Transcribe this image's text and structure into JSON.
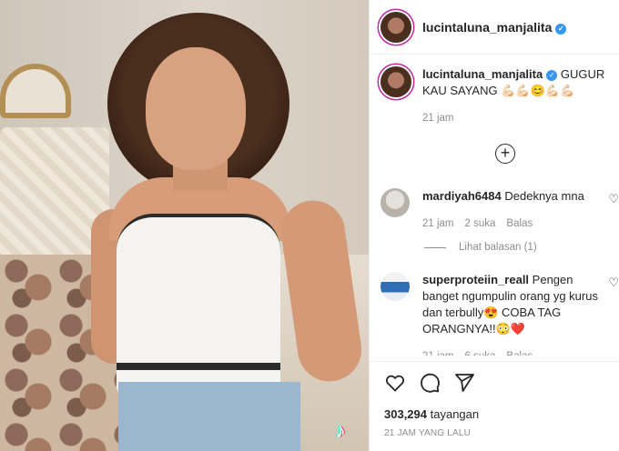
{
  "post": {
    "username": "lucintaluna_manjalita",
    "verified_icon": "verified-badge-icon",
    "caption_text": "GUGUR KAU SAYANG 💪🏻💪🏻😊💪🏻💪🏻",
    "caption_time": "21 jam",
    "views_count": "303,294",
    "views_label": "tayangan",
    "posted_time": "21 JAM YANG LALU"
  },
  "media": {
    "watermark_icon": "tiktok-logo-icon",
    "watermark_glyph": "♪"
  },
  "comments": [
    {
      "username": "mardiyah6484",
      "text": "Dedeknya mna",
      "time": "21 jam",
      "likes": "2 suka",
      "reply_label": "Balas",
      "view_replies": "Lihat balasan (1)"
    },
    {
      "username": "superproteiin_reall",
      "text": "Pengen banget ngumpulin orang yg kurus dan terbully😍 COBA TAG ORANGNYA!!😳❤️",
      "time": "21 jam",
      "likes": "6 suka",
      "reply_label": "Balas"
    }
  ],
  "icons": {
    "add_comments": "plus-circle-icon",
    "like": "heart-icon",
    "comment": "comment-icon",
    "share": "share-icon"
  },
  "colors": {
    "verified_blue": "#3897f0",
    "secondary_text": "#8e8e8e",
    "primary_text": "#262626"
  }
}
